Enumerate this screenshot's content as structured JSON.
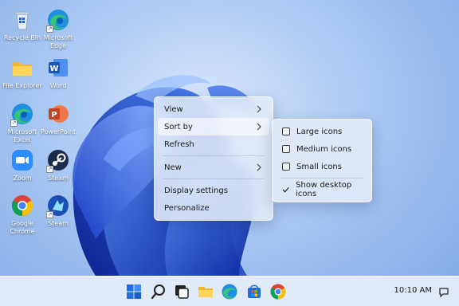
{
  "desktop": {
    "icons": [
      {
        "label": "Recycle Bin",
        "icon": "recycle-bin-icon"
      },
      {
        "label": "Microsoft Edge",
        "icon": "edge-icon"
      },
      {
        "label": "File Explorer",
        "icon": "folder-icon"
      },
      {
        "label": "Word",
        "icon": "word-icon"
      },
      {
        "label": "Microsoft Excel",
        "icon": "edge-icon"
      },
      {
        "label": "PowerPoint",
        "icon": "powerpoint-icon"
      },
      {
        "label": "Zoom",
        "icon": "zoom-icon"
      },
      {
        "label": "Steam",
        "icon": "steam-icon"
      },
      {
        "label": "Google Chrome",
        "icon": "chrome-icon"
      },
      {
        "label": "Steam",
        "icon": "steam-icon"
      }
    ]
  },
  "context_menu": {
    "items": [
      {
        "label": "View",
        "submenu": true
      },
      {
        "label": "Sort by",
        "submenu": true,
        "highlighted": true
      },
      {
        "label": "Refresh",
        "submenu": false
      },
      {
        "label": "New",
        "submenu": true
      },
      {
        "label": "Display settings",
        "submenu": false
      },
      {
        "label": "Personalize",
        "submenu": false
      }
    ]
  },
  "submenu": {
    "items": [
      {
        "label": "Large icons",
        "checked": false
      },
      {
        "label": "Medium icons",
        "checked": false
      },
      {
        "label": "Small icons",
        "checked": false
      },
      {
        "label": "Show desktop icons",
        "checked": true
      }
    ]
  },
  "taskbar": {
    "icons": [
      "windows-start-icon",
      "search-icon",
      "task-view-icon",
      "file-explorer-icon",
      "edge-icon",
      "store-icon",
      "chrome-icon"
    ],
    "clock": "10:10 AM",
    "notification_icon": "notification-icon"
  },
  "colors": {
    "accent": "#1f5fd6",
    "wallpaper_dark": "#0f2fa8",
    "wallpaper_light": "#3f7cf0"
  }
}
